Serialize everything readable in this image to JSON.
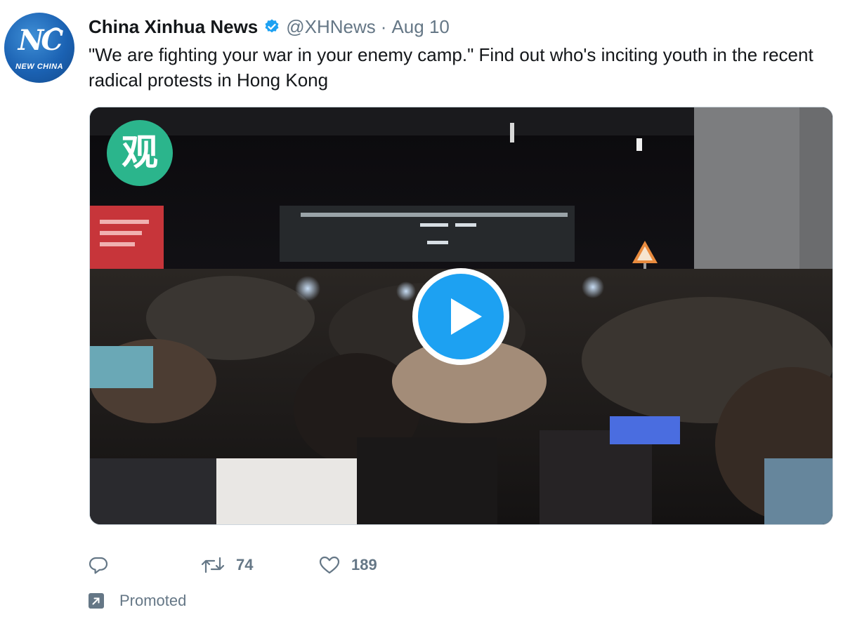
{
  "tweet": {
    "avatar": {
      "logo_text": "NEW CHINA"
    },
    "author": {
      "display_name": "China Xinhua News",
      "handle": "@XHNews",
      "separator": "·",
      "date": "Aug 10",
      "verified": true
    },
    "text": "\"We are fighting your war in your enemy camp.\" Find out who's inciting youth in the recent radical protests in Hong Kong",
    "media": {
      "type": "video",
      "badge_glyph": "观"
    },
    "actions": {
      "reply_count": "",
      "retweet_count": "74",
      "like_count": "189"
    },
    "promoted_label": "Promoted"
  },
  "colors": {
    "text": "#14171a",
    "secondary": "#657786",
    "accent": "#1da1f2",
    "badge": "#2bb58c"
  },
  "icons": [
    "verified-badge-icon",
    "play-icon",
    "reply-icon",
    "retweet-icon",
    "like-icon",
    "promoted-icon"
  ]
}
